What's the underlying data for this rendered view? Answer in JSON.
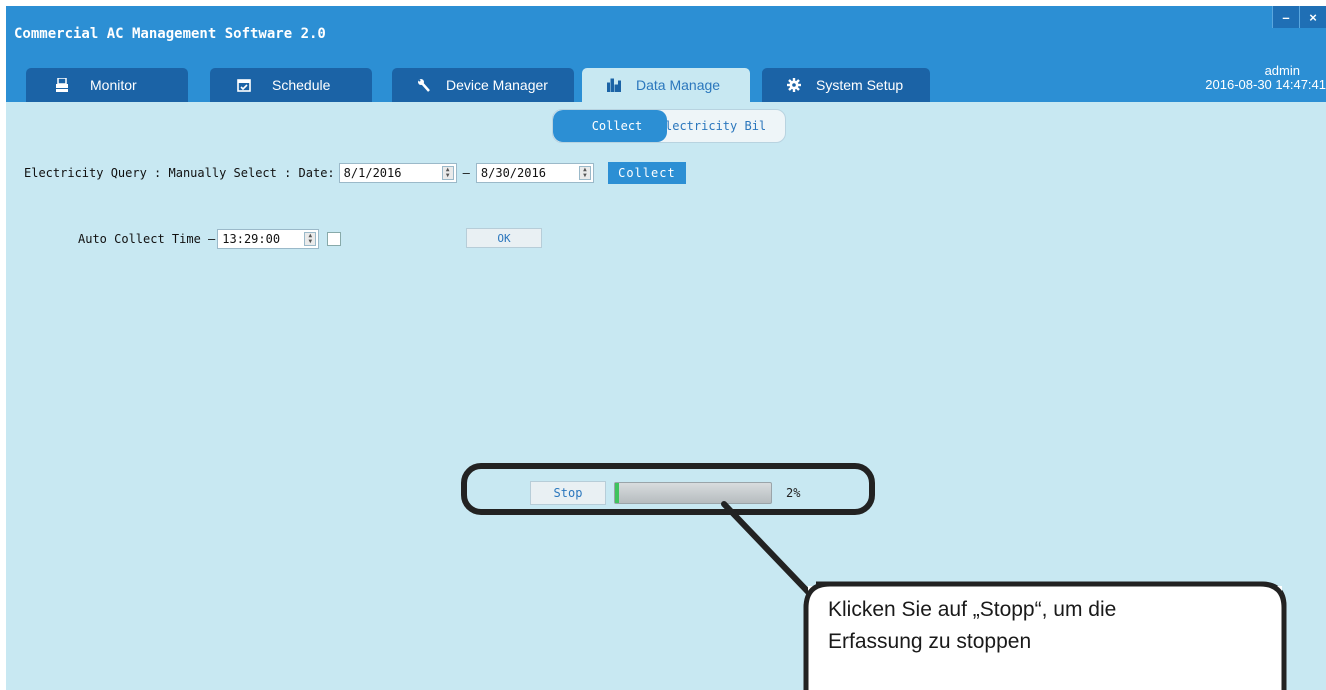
{
  "app": {
    "title": "Commercial AC Management Software 2.0",
    "minimize_label": "–",
    "close_label": "×"
  },
  "tabs": [
    {
      "label": "Monitor",
      "icon": "printer-icon"
    },
    {
      "label": "Schedule",
      "icon": "calendar-icon"
    },
    {
      "label": "Device Manager",
      "icon": "wrench-icon"
    },
    {
      "label": "Data Manage",
      "icon": "bar-chart-icon",
      "active": true
    },
    {
      "label": "System Setup",
      "icon": "gear-icon"
    }
  ],
  "user": {
    "name": "admin",
    "datetime": "2016-08-30 14:47:41"
  },
  "subtabs": {
    "collect": "Collect",
    "bill": "lectricity Bil"
  },
  "query": {
    "label": "Electricity  Query : Manually  Select : Date:",
    "date_from": "8/1/2016",
    "separator": "–",
    "date_to": "8/30/2016",
    "collect_button": "Collect"
  },
  "auto": {
    "label": "Auto Collect   Time –",
    "time": "13:29:00",
    "ok_button": "OK"
  },
  "progress": {
    "stop_button": "Stop",
    "value": 2,
    "label": "2%"
  },
  "callout": {
    "text_line1": "Klicken Sie auf „Stopp“, um die",
    "text_line2": "Erfassung zu stoppen"
  },
  "colors": {
    "header": "#2c8fd4",
    "tab": "#1b63a6",
    "content_bg": "#c8e8f2",
    "progress_fill": "#3fc35e"
  }
}
